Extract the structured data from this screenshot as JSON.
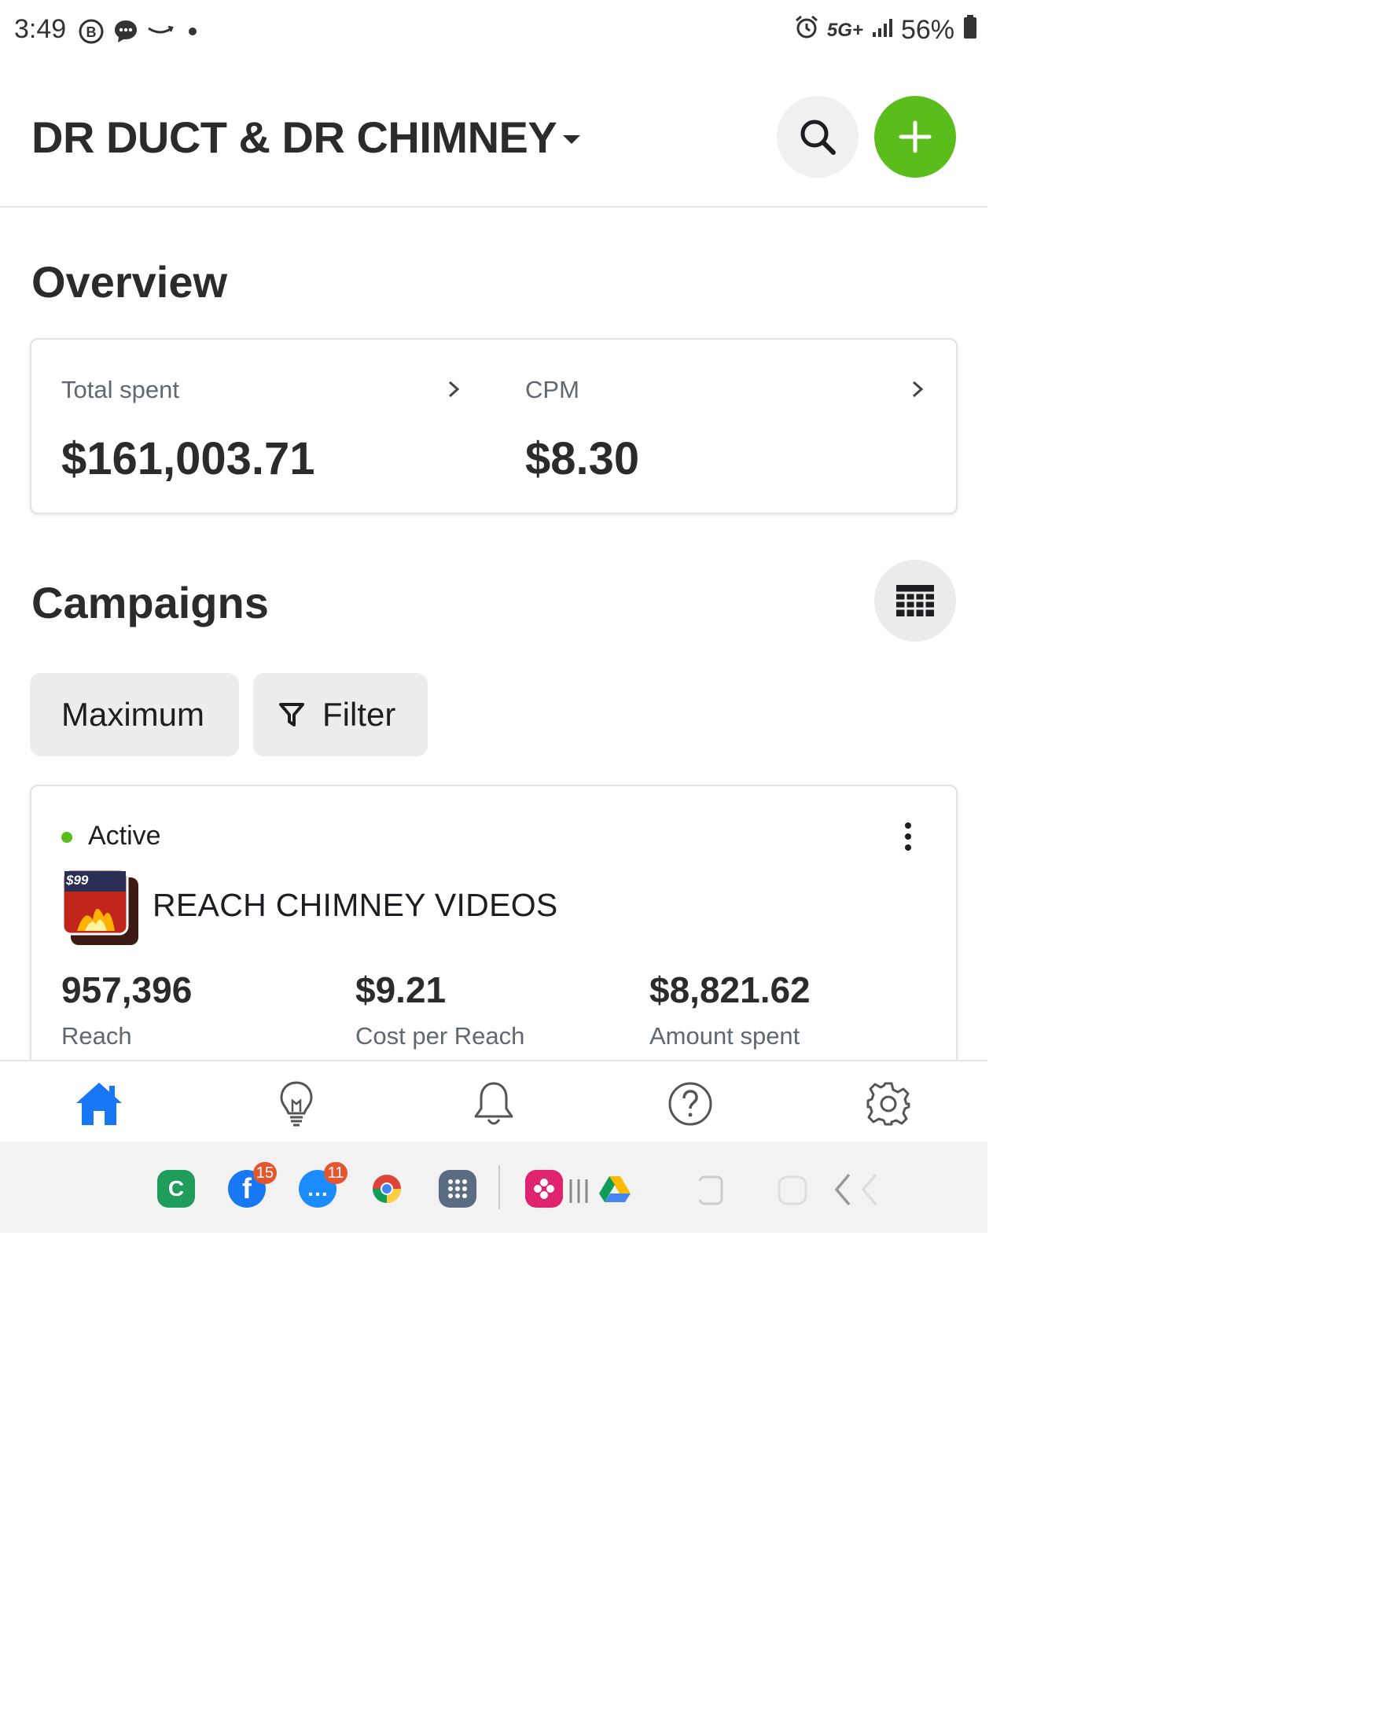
{
  "status_bar": {
    "time": "3:49",
    "left_icons": [
      "b-circle-icon",
      "chat-bubble-icon",
      "amazon-smile-icon",
      "dot-icon"
    ],
    "network": "5G+",
    "battery": "56%"
  },
  "header": {
    "account_name": "DR DUCT & DR CHIMNEY",
    "accent_color": "#5bbd1b"
  },
  "overview": {
    "title": "Overview",
    "total_spent_label": "Total spent",
    "total_spent_value": "$161,003.71",
    "cpm_label": "CPM",
    "cpm_value": "$8.30"
  },
  "campaigns": {
    "title": "Campaigns",
    "sort_label": "Maximum",
    "filter_label": "Filter",
    "items": [
      {
        "status": "Active",
        "status_color": "#5bbd1b",
        "name": "REACH CHIMNEY VIDEOS",
        "thumb_text": "$99",
        "metrics": [
          {
            "value": "957,396",
            "label": "Reach"
          },
          {
            "value": "$9.21",
            "label": "Cost per Reach"
          },
          {
            "value": "$8,821.62",
            "label": "Amount spent"
          }
        ]
      }
    ]
  },
  "bottom_nav": [
    "home-icon",
    "lightbulb-icon",
    "bell-icon",
    "help-icon",
    "settings-icon"
  ],
  "dock": {
    "apps": [
      {
        "name": "c-app-icon",
        "letter": "C",
        "color": "#1e9e5a"
      },
      {
        "name": "facebook-app-icon",
        "letter": "f",
        "color": "#1877f2",
        "badge": "15"
      },
      {
        "name": "messages-app-icon",
        "letter": "…",
        "color": "#1a8cff",
        "badge": "11"
      },
      {
        "name": "chrome-app-icon"
      },
      {
        "name": "apps-grid-icon",
        "color": "#5b6b82"
      },
      {
        "name": "gallery-app-icon",
        "color": "#e0236f"
      },
      {
        "name": "drive-app-icon"
      }
    ]
  }
}
